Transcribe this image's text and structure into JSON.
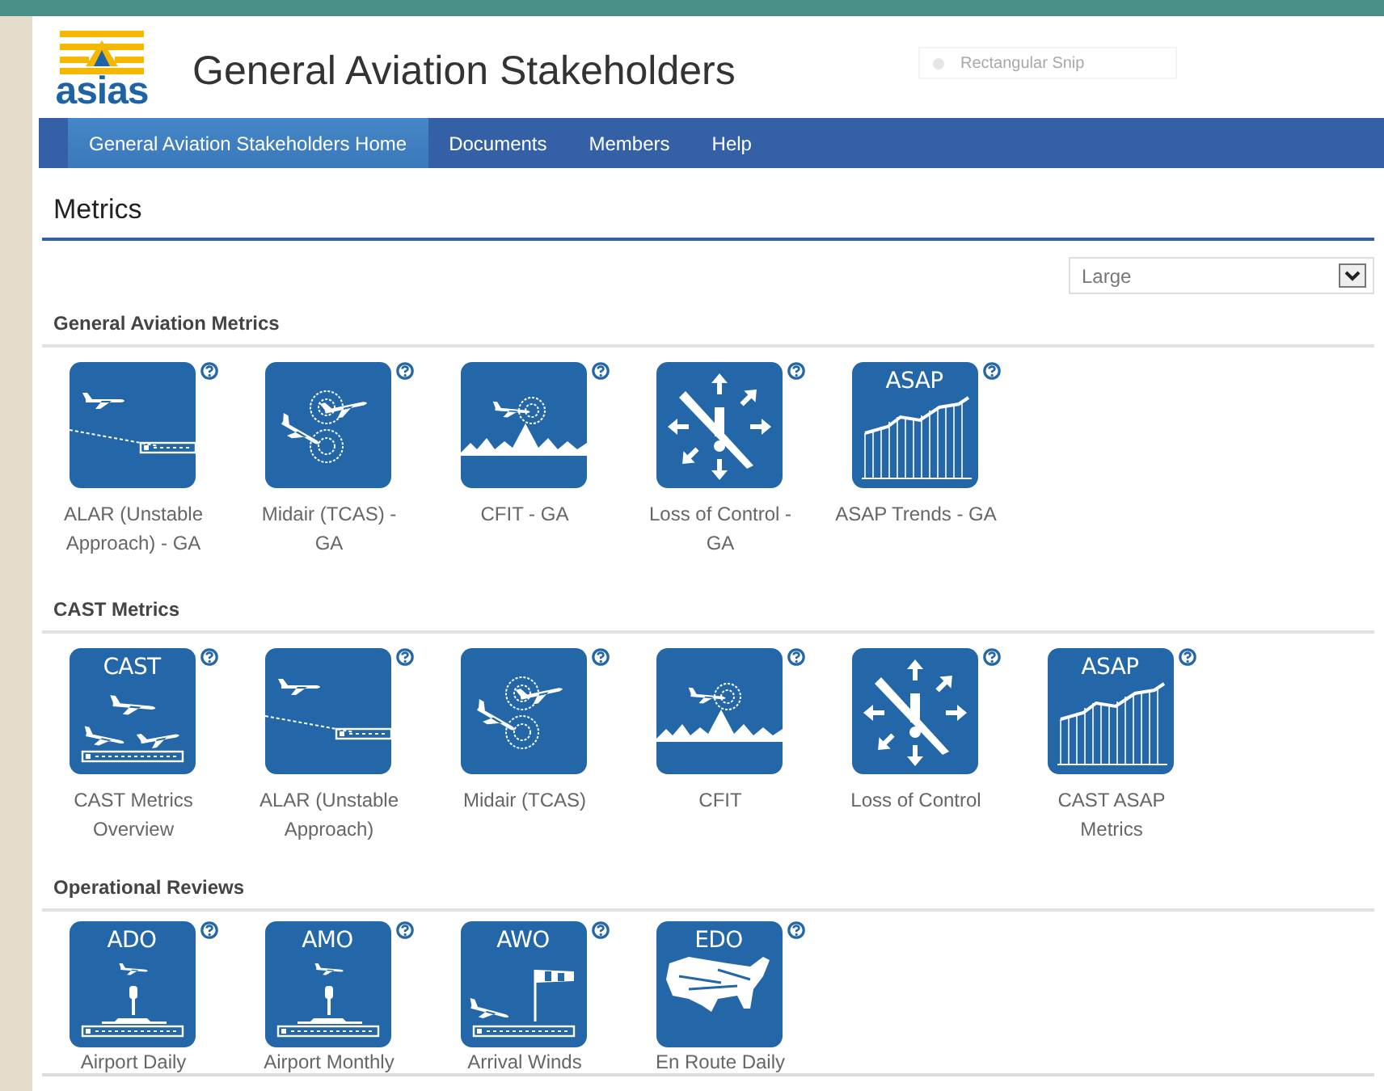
{
  "header": {
    "logo_text": "asias",
    "title": "General Aviation Stakeholders"
  },
  "snip_toolbar": {
    "label": "Rectangular Snip"
  },
  "nav": [
    {
      "label": "General Aviation Stakeholders Home",
      "selected": true
    },
    {
      "label": "Documents",
      "selected": false
    },
    {
      "label": "Members",
      "selected": false
    },
    {
      "label": "Help",
      "selected": false
    }
  ],
  "page_title": "Metrics",
  "size_select": {
    "value": "Large"
  },
  "sections": [
    {
      "title": "General Aviation Metrics",
      "tiles": [
        {
          "kind": "alar",
          "label": "ALAR (Unstable Approach) - GA"
        },
        {
          "kind": "midair",
          "label": "Midair (TCAS) - GA"
        },
        {
          "kind": "cfit",
          "label": "CFIT - GA"
        },
        {
          "kind": "loss",
          "label": "Loss of Control - GA"
        },
        {
          "kind": "asap",
          "badge": "ASAP",
          "label": "ASAP Trends - GA"
        }
      ]
    },
    {
      "title": "CAST Metrics",
      "tiles": [
        {
          "kind": "cast",
          "badge": "CAST",
          "label": "CAST Metrics Overview"
        },
        {
          "kind": "alar",
          "label": "ALAR (Unstable Approach)"
        },
        {
          "kind": "midair",
          "label": "Midair (TCAS)"
        },
        {
          "kind": "cfit",
          "label": "CFIT"
        },
        {
          "kind": "loss",
          "label": "Loss of Control"
        },
        {
          "kind": "asap",
          "badge": "ASAP",
          "label": "CAST ASAP Metrics"
        }
      ]
    },
    {
      "title": "Operational Reviews",
      "tiles": [
        {
          "kind": "tower",
          "badge": "ADO",
          "label": "Airport Daily"
        },
        {
          "kind": "tower",
          "badge": "AMO",
          "label": "Airport Monthly"
        },
        {
          "kind": "windsock",
          "badge": "AWO",
          "label": "Arrival Winds"
        },
        {
          "kind": "map",
          "badge": "EDO",
          "label": "En Route Daily"
        }
      ]
    }
  ]
}
